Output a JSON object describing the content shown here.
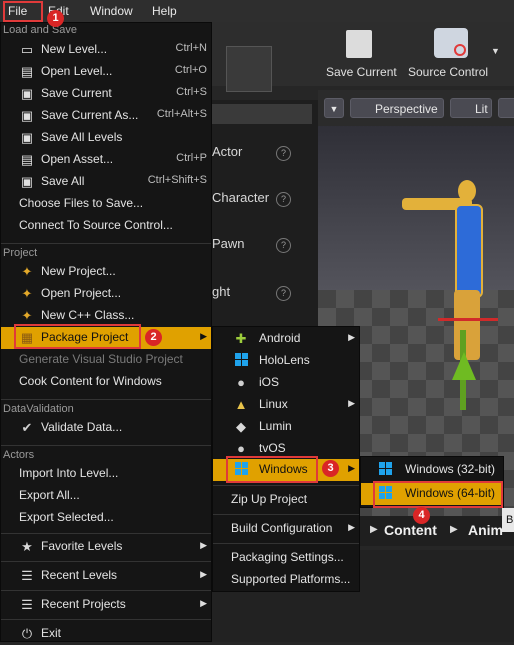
{
  "menubar": {
    "items": [
      "File",
      "Edit",
      "Window",
      "Help"
    ]
  },
  "toolbar": {
    "save_current": "Save Current",
    "source_control": "Source Control"
  },
  "viewport": {
    "perspective": "Perspective",
    "lit": "Lit"
  },
  "left_panel": {
    "rows": [
      "Actor",
      "Character",
      "Pawn",
      "ght"
    ]
  },
  "content_bar": {
    "content": "Content",
    "anim": "Anim",
    "extra": "B"
  },
  "file_menu": {
    "sections": {
      "load_save": "Load and Save",
      "project": "Project",
      "data_validation": "DataValidation",
      "actors": "Actors"
    },
    "items": {
      "new_level": {
        "label": "New Level...",
        "shortcut": "Ctrl+N"
      },
      "open_level": {
        "label": "Open Level...",
        "shortcut": "Ctrl+O"
      },
      "save_current": {
        "label": "Save Current",
        "shortcut": "Ctrl+S"
      },
      "save_current_as": {
        "label": "Save Current As...",
        "shortcut": "Ctrl+Alt+S"
      },
      "save_all_levels": {
        "label": "Save All Levels"
      },
      "open_asset": {
        "label": "Open Asset...",
        "shortcut": "Ctrl+P"
      },
      "save_all": {
        "label": "Save All",
        "shortcut": "Ctrl+Shift+S"
      },
      "choose_files": {
        "label": "Choose Files to Save..."
      },
      "connect_source": {
        "label": "Connect To Source Control..."
      },
      "new_project": {
        "label": "New Project..."
      },
      "open_project": {
        "label": "Open Project..."
      },
      "new_cpp_class": {
        "label": "New C++ Class..."
      },
      "package_project": {
        "label": "Package Project"
      },
      "generate_vs": {
        "label": "Generate Visual Studio Project"
      },
      "cook_content": {
        "label": "Cook Content for Windows"
      },
      "validate_data": {
        "label": "Validate Data..."
      },
      "import_into_level": {
        "label": "Import Into Level..."
      },
      "export_all": {
        "label": "Export All..."
      },
      "export_selected": {
        "label": "Export Selected..."
      },
      "favorite_levels": {
        "label": "Favorite Levels"
      },
      "recent_levels": {
        "label": "Recent Levels"
      },
      "recent_projects": {
        "label": "Recent Projects"
      },
      "exit": {
        "label": "Exit"
      }
    }
  },
  "platform_menu": {
    "items": [
      "Android",
      "HoloLens",
      "iOS",
      "Linux",
      "Lumin",
      "tvOS",
      "Windows"
    ],
    "zip_up": "Zip Up Project",
    "build_configuration": "Build Configuration",
    "packaging_settings": "Packaging Settings...",
    "supported_platforms": "Supported Platforms..."
  },
  "windows_menu": {
    "items": [
      "Windows (32-bit)",
      "Windows (64-bit)"
    ]
  },
  "badges": [
    "1",
    "2",
    "3",
    "4"
  ],
  "colors": {
    "highlight": "#e0a100",
    "annotation": "#e03a3a",
    "menu_bg": "#151515"
  }
}
